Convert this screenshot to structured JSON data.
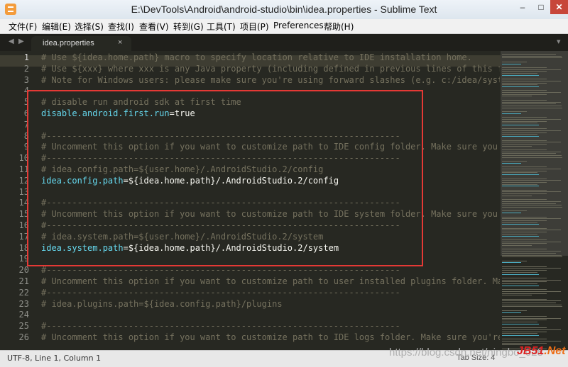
{
  "window": {
    "title": "E:\\DevTools\\Android\\android-studio\\bin\\idea.properties - Sublime Text",
    "minimize": "–",
    "maximize": "□",
    "close": "✕"
  },
  "menu": [
    "文件(F)",
    "编辑(E)",
    "选择(S)",
    "查找(I)",
    "查看(V)",
    "转到(G)",
    "工具(T)",
    "项目(P)",
    "Preferences",
    "帮助(H)"
  ],
  "tabs": {
    "active": "idea.properties",
    "close_glyph": "×",
    "left_arrow": "◀",
    "right_arrow": "▶",
    "more": "▾"
  },
  "editor": {
    "line_numbers": [
      "1",
      "2",
      "3",
      "4",
      "5",
      "6",
      "7",
      "8",
      "9",
      "10",
      "11",
      "12",
      "13",
      "14",
      "15",
      "16",
      "17",
      "18",
      "19",
      "20",
      "21",
      "22",
      "23",
      "24",
      "25",
      "26"
    ],
    "lines": [
      "# Use ${idea.home.path} macro to specify location relative to IDE installation home.",
      "# Use ${xxx} where xxx is any Java property (including defined in previous lines of this file",
      "# Note for Windows users: please make sure you're using forward slashes (e.g. c:/idea/system).",
      "",
      "# disable run android sdk at first time",
      "disable.android.first.run=true",
      "",
      "#---------------------------------------------------------------------",
      "# Uncomment this option if you want to customize path to IDE config folder. Make sure you're",
      "#---------------------------------------------------------------------",
      "# idea.config.path=${user.home}/.AndroidStudio.2/config",
      "idea.config.path=${idea.home.path}/.AndroidStudio.2/config",
      "",
      "#---------------------------------------------------------------------",
      "# Uncomment this option if you want to customize path to IDE system folder. Make sure you're",
      "#---------------------------------------------------------------------",
      "# idea.system.path=${user.home}/.AndroidStudio.2/system",
      "idea.system.path=${idea.home.path}/.AndroidStudio.2/system",
      "",
      "#---------------------------------------------------------------------",
      "# Uncomment this option if you want to customize path to user installed plugins folder. Make",
      "#---------------------------------------------------------------------",
      "# idea.plugins.path=${idea.config.path}/plugins",
      "",
      "#---------------------------------------------------------------------",
      "# Uncomment this option if you want to customize path to IDE logs folder. Make sure you're u"
    ]
  },
  "status": {
    "text": "UTF-8, Line 1, Column 1",
    "tab_size": "Tab Size: 4"
  },
  "overlay": {
    "watermark": "https://blog.csdn.net/ningbo_028",
    "logo_part1": "JB",
    "logo_part2": "51",
    "logo_part3": ".Net"
  },
  "colors": {
    "background": "#272822",
    "comment": "#75715e",
    "key": "#66d9ef",
    "value": "#f8f8f2",
    "highlight_box": "#e53935"
  }
}
